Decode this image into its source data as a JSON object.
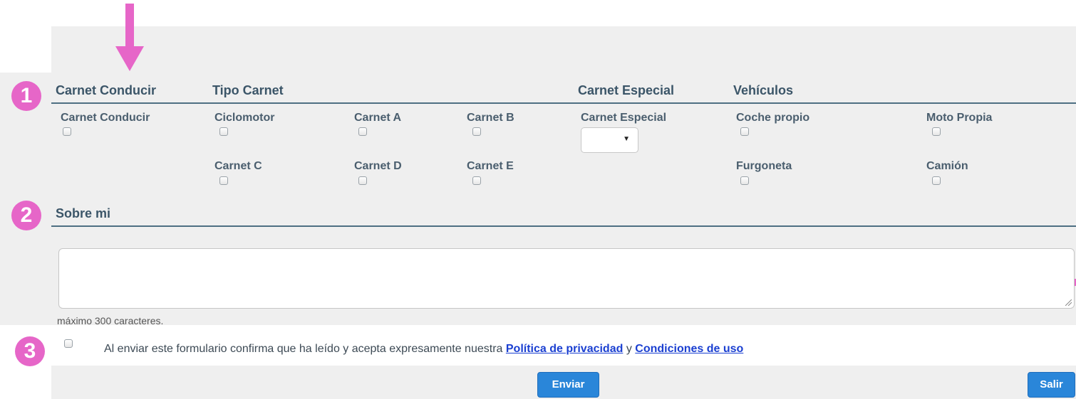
{
  "badges": [
    "1",
    "2",
    "3"
  ],
  "headers": {
    "carnet_conducir": "Carnet Conducir",
    "tipo_carnet": "Tipo Carnet",
    "carnet_especial": "Carnet Especial",
    "vehiculos": "Vehículos",
    "sobre_mi": "Sobre mi"
  },
  "fields": {
    "carnet_conducir": "Carnet Conducir",
    "ciclomotor": "Ciclomotor",
    "carnet_a": "Carnet A",
    "carnet_b": "Carnet B",
    "carnet_especial": "Carnet Especial",
    "coche_propio": "Coche propio",
    "moto_propia": "Moto Propia",
    "carnet_c": "Carnet C",
    "carnet_d": "Carnet D",
    "carnet_e": "Carnet E",
    "furgoneta": "Furgoneta",
    "camion": "Camión"
  },
  "select": {
    "value": "",
    "caret": "▼"
  },
  "sobre_mi": {
    "value": "",
    "hint": "máximo 300 caracteres."
  },
  "consent": {
    "text": "Al enviar este formulario confirma que ha leído y acepta expresamente nuestra",
    "privacy_link": "Política de privacidad",
    "and": "y",
    "terms_link": "Condiciones de uso"
  },
  "buttons": {
    "submit": "Enviar",
    "exit": "Salir"
  },
  "colors": {
    "accent": "#e666c8",
    "button": "#2a86d9",
    "link": "#1a3fd1",
    "panel": "#efefef"
  }
}
